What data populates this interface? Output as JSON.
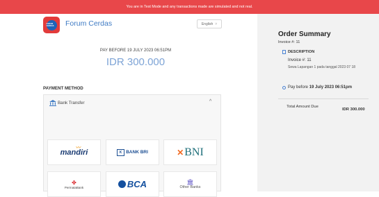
{
  "banner": {
    "text": "You are in Test Mode and any transactions made are simulated and not real."
  },
  "merchant": {
    "logo_text": "FORUM CERDAS",
    "name": "Forum Cerdas"
  },
  "language": {
    "selected": "English",
    "chevron": "˅"
  },
  "payment": {
    "pay_before": "PAY BEFORE 19 JULY 2023 06:51PM",
    "amount": "IDR 300.000"
  },
  "payment_method": {
    "title": "PAYMENT METHOD",
    "group_label": "Bank Transfer",
    "caret": "^",
    "banks": {
      "mandiri": "mandiri",
      "bri": "BANK BRI",
      "bni": "BNI",
      "permata": "PermataBank",
      "bca": "BCA",
      "other": "Other Banks"
    }
  },
  "order_summary": {
    "title": "Order Summary",
    "invoice": "Invoice #: 11",
    "description_label": "DESCRIPTION",
    "description_invoice": "Invoice #: 11",
    "description_detail": "Sewa Lapangan 1 pada tanggal 2023 07 18",
    "pay_before_prefix": "Pay before",
    "pay_before_value": "19 July 2023 06:51pm",
    "total_label": "Total Amount Due",
    "total_value": "IDR 300.000"
  },
  "colors": {
    "banner": "#e8474a",
    "accent": "#3f7bc4",
    "amount": "#7ea4d6",
    "summary_bg": "#f2f2f2"
  }
}
